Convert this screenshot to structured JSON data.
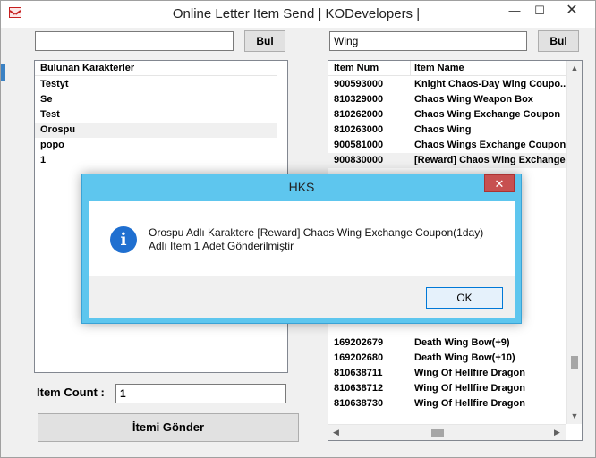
{
  "window": {
    "title": "Online Letter Item Send | KODevelopers |",
    "minimize_glyph": "—",
    "maximize_glyph": "☐",
    "close_glyph": "✕"
  },
  "left": {
    "search_value": "",
    "search_button": "Bul",
    "list_header": "Bulunan Karakterler",
    "characters": [
      "Testyt",
      "Se",
      "Test",
      "Orospu",
      "popo",
      "1"
    ],
    "item_count_label": "Item Count :",
    "item_count_value": "1",
    "send_button": "İtemi Gönder"
  },
  "right": {
    "search_value": "Wing",
    "search_button": "Bul",
    "col_num": "Item Num",
    "col_name": "Item Name",
    "items_top": [
      {
        "num": "900593000",
        "name": "Knight Chaos-Day Wing Coupo..."
      },
      {
        "num": "810329000",
        "name": "Chaos Wing Weapon Box"
      },
      {
        "num": "810262000",
        "name": "Chaos Wing Exchange Coupon"
      },
      {
        "num": "810263000",
        "name": "Chaos Wing"
      },
      {
        "num": "900581000",
        "name": "Chaos Wings Exchange Coupon"
      },
      {
        "num": "900830000",
        "name": "[Reward] Chaos Wing Exchange"
      }
    ],
    "items_bottom": [
      {
        "num": "169202679",
        "name": "Death Wing Bow(+9)"
      },
      {
        "num": "169202680",
        "name": "Death Wing Bow(+10)"
      },
      {
        "num": "810638711",
        "name": "Wing Of Hellfire Dragon"
      },
      {
        "num": "810638712",
        "name": "Wing Of Hellfire Dragon"
      },
      {
        "num": "810638730",
        "name": "Wing Of Hellfire Dragon"
      }
    ]
  },
  "dialog": {
    "title": "HKS",
    "close_glyph": "✕",
    "icon_glyph": "i",
    "message_line1": "Orospu Adlı Karaktere [Reward] Chaos Wing Exchange Coupon(1day)",
    "message_line2": "Adlı Item 1 Adet Gönderilmiştir",
    "ok_button": "OK"
  },
  "colors": {
    "dialog_frame": "#5ec6ee",
    "dialog_close": "#c75050",
    "info_icon": "#1f6fd0"
  }
}
